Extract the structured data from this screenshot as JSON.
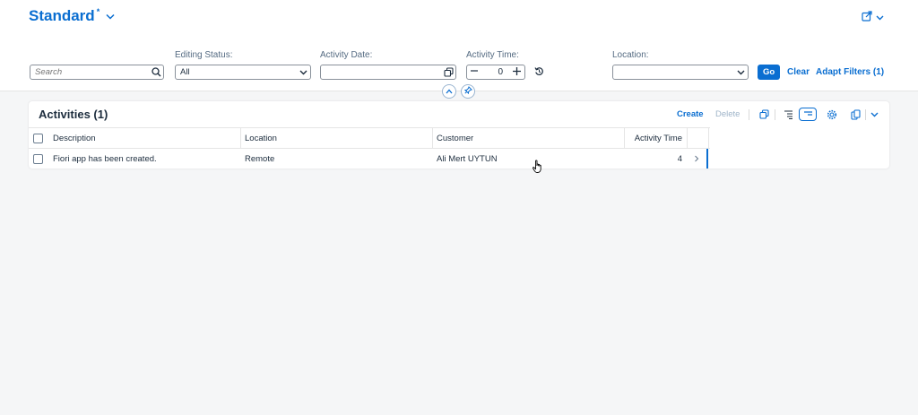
{
  "variant": {
    "title": "Standard",
    "modified_marker": "*"
  },
  "filters": {
    "search": {
      "placeholder": "Search",
      "value": ""
    },
    "editing_status": {
      "label": "Editing Status:",
      "value": "All"
    },
    "activity_date": {
      "label": "Activity Date:",
      "value": ""
    },
    "activity_time": {
      "label": "Activity Time:",
      "value": "0"
    },
    "location": {
      "label": "Location:",
      "value": ""
    },
    "go_label": "Go",
    "clear_label": "Clear",
    "adapt_label": "Adapt Filters (1)"
  },
  "table": {
    "title": "Activities (1)",
    "toolbar": {
      "create_label": "Create",
      "delete_label": "Delete"
    },
    "columns": [
      "Description",
      "Location",
      "Customer",
      "Activity Time"
    ],
    "rows": [
      {
        "description": "Fiori app has been created.",
        "location": "Remote",
        "customer": "Ali Mert UYTUN",
        "activity_time": "4"
      }
    ]
  },
  "colors": {
    "accent": "#0a6ed1",
    "text": "#1d2d3e",
    "background": "#f5f6f7"
  },
  "icons": [
    "chevron-down-icon",
    "share-icon",
    "search-icon",
    "calendar-icon",
    "minus-icon",
    "plus-icon",
    "reset-icon",
    "chevron-up-icon",
    "pin-icon",
    "copy-icon",
    "expand-rows-icon",
    "collapse-rows-icon",
    "settings-icon",
    "export-icon",
    "chevron-right-icon",
    "hand-cursor-icon"
  ]
}
